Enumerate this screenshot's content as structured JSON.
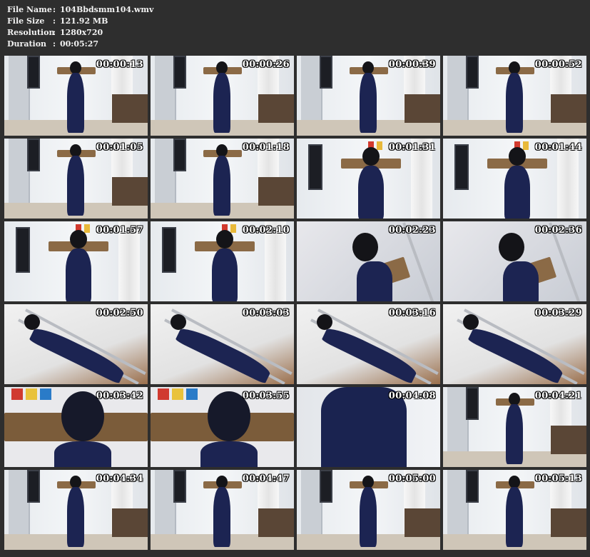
{
  "file_info": {
    "name_label": "File Name",
    "name_value": "104Bbdsmm104.wmv",
    "size_label": "File Size",
    "size_value": "121.92 MB",
    "resolution_label": "Resolution",
    "resolution_value": "1280x720",
    "duration_label": "Duration",
    "duration_value": "00:05:27",
    "separator": ":"
  },
  "thumbnails": [
    {
      "time": "00:00:13",
      "scene": "standing"
    },
    {
      "time": "00:00:26",
      "scene": "standing"
    },
    {
      "time": "00:00:39",
      "scene": "standing"
    },
    {
      "time": "00:00:52",
      "scene": "standing"
    },
    {
      "time": "00:01:05",
      "scene": "standing"
    },
    {
      "time": "00:01:18",
      "scene": "standing"
    },
    {
      "time": "00:01:31",
      "scene": "standing-close"
    },
    {
      "time": "00:01:44",
      "scene": "standing-close"
    },
    {
      "time": "00:01:57",
      "scene": "standing-close"
    },
    {
      "time": "00:02:10",
      "scene": "standing-close"
    },
    {
      "time": "00:02:23",
      "scene": "closeup-side"
    },
    {
      "time": "00:02:36",
      "scene": "closeup-side"
    },
    {
      "time": "00:02:50",
      "scene": "lying"
    },
    {
      "time": "00:03:03",
      "scene": "lying"
    },
    {
      "time": "00:03:16",
      "scene": "lying"
    },
    {
      "time": "00:03:29",
      "scene": "lying"
    },
    {
      "time": "00:03:42",
      "scene": "board-close"
    },
    {
      "time": "00:03:55",
      "scene": "board-close"
    },
    {
      "time": "00:04:08",
      "scene": "dress-close"
    },
    {
      "time": "00:04:21",
      "scene": "standing"
    },
    {
      "time": "00:04:34",
      "scene": "standing"
    },
    {
      "time": "00:04:47",
      "scene": "standing"
    },
    {
      "time": "00:05:00",
      "scene": "standing"
    },
    {
      "time": "00:05:13",
      "scene": "standing"
    }
  ]
}
